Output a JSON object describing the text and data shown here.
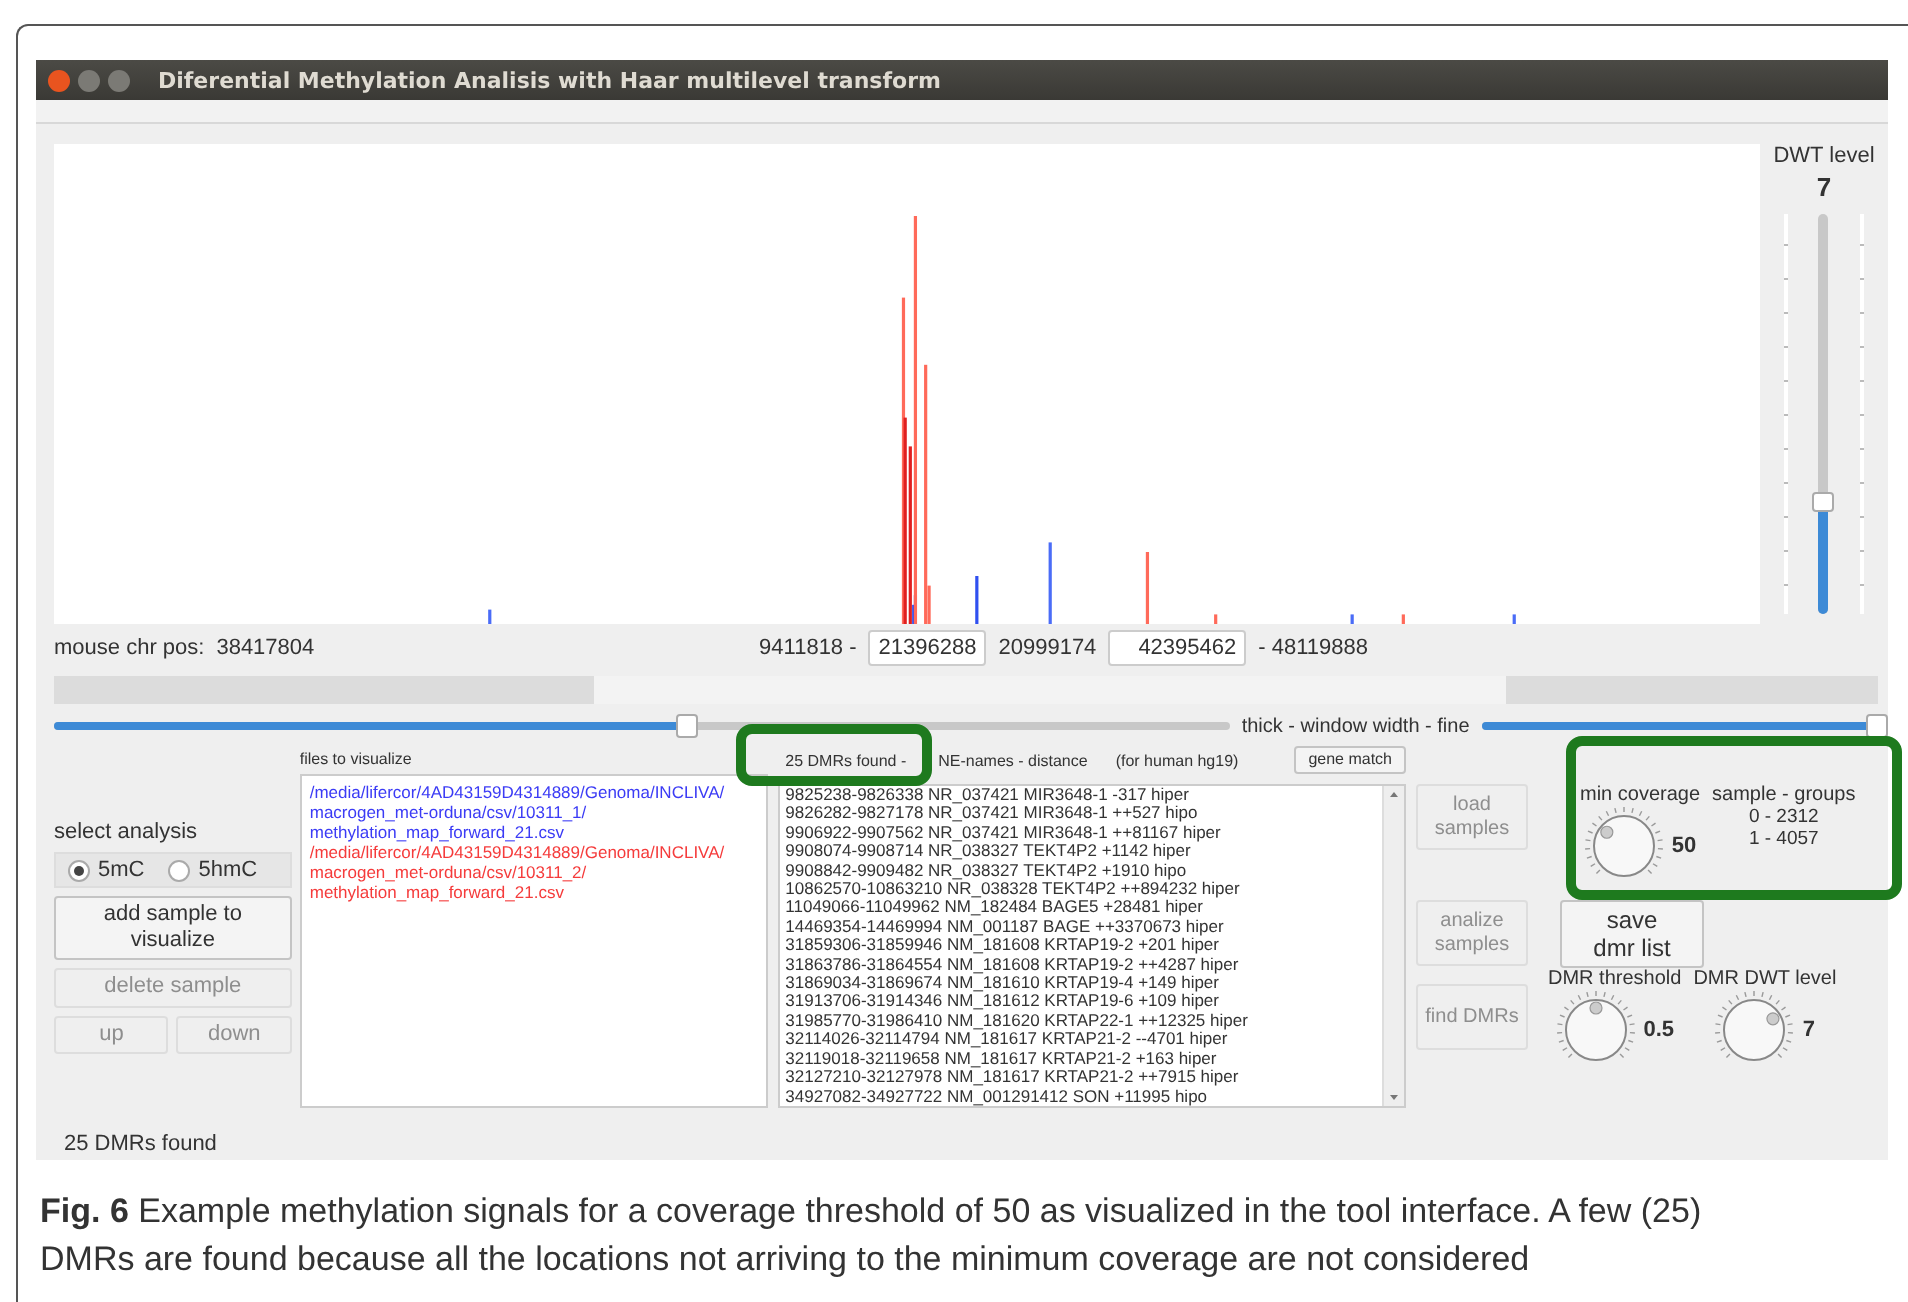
{
  "window": {
    "title": "Diferential Methylation Analisis with Haar multilevel transform"
  },
  "dwt": {
    "label": "DWT level",
    "value": "7",
    "level": 0.28
  },
  "position_bar": {
    "label": "mouse chr pos:",
    "value": "38417804",
    "range_start": "9411818 -",
    "field_1": "21396288",
    "middle": "20999174",
    "field_2": "42395462",
    "range_end": "- 48119888"
  },
  "window_width": {
    "label": "thick - window width - fine",
    "sliders": [
      {
        "level": 0.54
      },
      {
        "level": 1
      }
    ]
  },
  "analysis": {
    "label": "select analysis",
    "options": [
      {
        "label": "5mC",
        "selected": true
      },
      {
        "label": "5hmC",
        "selected": false
      }
    ]
  },
  "sample_buttons": [
    {
      "label": "add sample to\nvisualize",
      "disabled": false
    },
    {
      "label": "delete sample",
      "disabled": true
    }
  ],
  "order_buttons": [
    {
      "label": "up",
      "disabled": true
    },
    {
      "label": "down",
      "disabled": true
    }
  ],
  "files": {
    "label": "files to visualize",
    "items": [
      {
        "lines": [
          "/media/lifercor/4AD43159D4314889/Genoma/INCLIVA/",
          "macrogen_met-orduna/csv/10311_1/",
          "methylation_map_forward_21.csv"
        ],
        "color": "#3b3bf5"
      },
      {
        "lines": [
          "/media/lifercor/4AD43159D4314889/Genoma/INCLIVA/",
          "macrogen_met-orduna/csv/10311_2/",
          "methylation_map_forward_21.csv"
        ],
        "color": "#f53b3b"
      }
    ]
  },
  "dmr_list": {
    "header": [
      "25 DMRs found  -",
      "NE-names -  distance",
      "(for human hg19)"
    ],
    "button": "gene match",
    "rows": [
      "9825238-9826338 NR_037421 MIR3648-1 -317 hiper",
      "9826282-9827178 NR_037421 MIR3648-1 ++527 hipo",
      "9906922-9907562 NR_037421 MIR3648-1 ++81167 hiper",
      "9908074-9908714 NR_038327 TEKT4P2 +1142 hiper",
      "9908842-9909482 NR_038327 TEKT4P2 +1910 hipo",
      "10862570-10863210 NR_038328 TEKT4P2 ++894232 hiper",
      "11049066-11049962 NM_182484 BAGE5 +28481 hiper",
      "14469354-14469994 NM_001187 BAGE ++3370673 hiper",
      "31859306-31859946 NM_181608 KRTAP19-2 +201 hiper",
      "31863786-31864554 NM_181608 KRTAP19-2 ++4287 hiper",
      "31869034-31869674 NM_181610 KRTAP19-4 +149 hiper",
      "31913706-31914346 NM_181612 KRTAP19-6 +109 hiper",
      "31985770-31986410 NM_181620 KRTAP22-1 ++12325 hiper",
      "32114026-32114794 NM_181617 KRTAP21-2 --4701 hiper",
      "32119018-32119658 NM_181617 KRTAP21-2 +163 hiper",
      "32127210-32127978 NM_181617 KRTAP21-2 ++7915 hiper",
      "34927082-34927722 NM_001291412 SON +11995 hipo"
    ]
  },
  "actions": [
    {
      "label": "load\nsamples",
      "disabled": true
    },
    {
      "label": "analize\nsamples",
      "disabled": true
    },
    {
      "label": "find DMRs",
      "disabled": true
    }
  ],
  "save_button": {
    "label": "save\ndmr list",
    "disabled": false
  },
  "knobs": [
    {
      "label": "min coverage",
      "value": "50"
    },
    {
      "label": "DMR threshold",
      "value": "0.5"
    },
    {
      "label": "DMR DWT level",
      "value": "7"
    }
  ],
  "sample_groups": {
    "title": "sample - groups",
    "lines": [
      "0 - 2312",
      "1 - 4057"
    ]
  },
  "status_bar": "25 DMRs found",
  "caption": "**Fig. 6**  Example methylation signals for a coverage threshold of 50 as visualized in the tool interface. A few (25) DMRs are found because all the locations not arriving to the minimum coverage are not considered"
}
